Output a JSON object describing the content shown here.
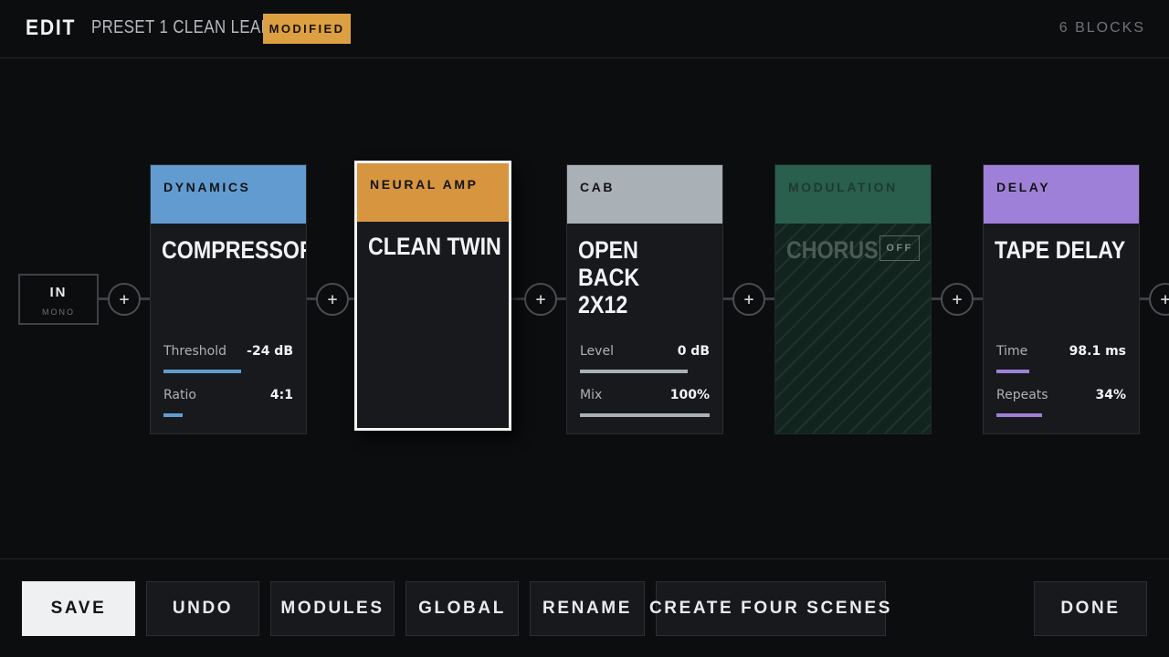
{
  "header": {
    "mode": "EDIT",
    "preset": "PRESET 1  CLEAN LEAD",
    "badge": "MODIFIED",
    "block_count": "6 BLOCKS"
  },
  "colors": {
    "accent": "#dca042",
    "dynamics": "#629bd0",
    "amp": "#d7953f",
    "cab": "#a9b0b6",
    "modulation": "#2a5e4d",
    "delay": "#9f80d8"
  },
  "chain": {
    "input": {
      "label": "IN",
      "sub": "MONO"
    },
    "add_icon": "plus-icon",
    "add_glyph": "+",
    "blocks": [
      {
        "category": "DYNAMICS",
        "name": "COMPRESSOR",
        "params": [
          {
            "label": "Threshold",
            "value": "-24 dB",
            "fraction": 0.6
          },
          {
            "label": "Ratio",
            "value": "4:1",
            "fraction": 0.15
          }
        ]
      },
      {
        "category": "NEURAL AMP",
        "name": "CLEAN TWIN",
        "selected": true,
        "params": []
      },
      {
        "category": "CAB",
        "name": "OPEN BACK 2X12",
        "params": [
          {
            "label": "Level",
            "value": "0 dB",
            "fraction": 0.83
          },
          {
            "label": "Mix",
            "value": "100%",
            "fraction": 1.0
          }
        ]
      },
      {
        "category": "MODULATION",
        "name": "CHORUS",
        "state": "OFF",
        "params": []
      },
      {
        "category": "DELAY",
        "name": "TAPE DELAY",
        "params": [
          {
            "label": "Time",
            "value": "98.1 ms",
            "fraction": 0.25
          },
          {
            "label": "Repeats",
            "value": "34%",
            "fraction": 0.35
          }
        ]
      }
    ]
  },
  "footer": {
    "save": "SAVE",
    "undo": "UNDO",
    "modules": "MODULES",
    "global": "GLOBAL",
    "rename": "RENAME",
    "create_scenes": "CREATE FOUR SCENES",
    "done": "DONE"
  }
}
